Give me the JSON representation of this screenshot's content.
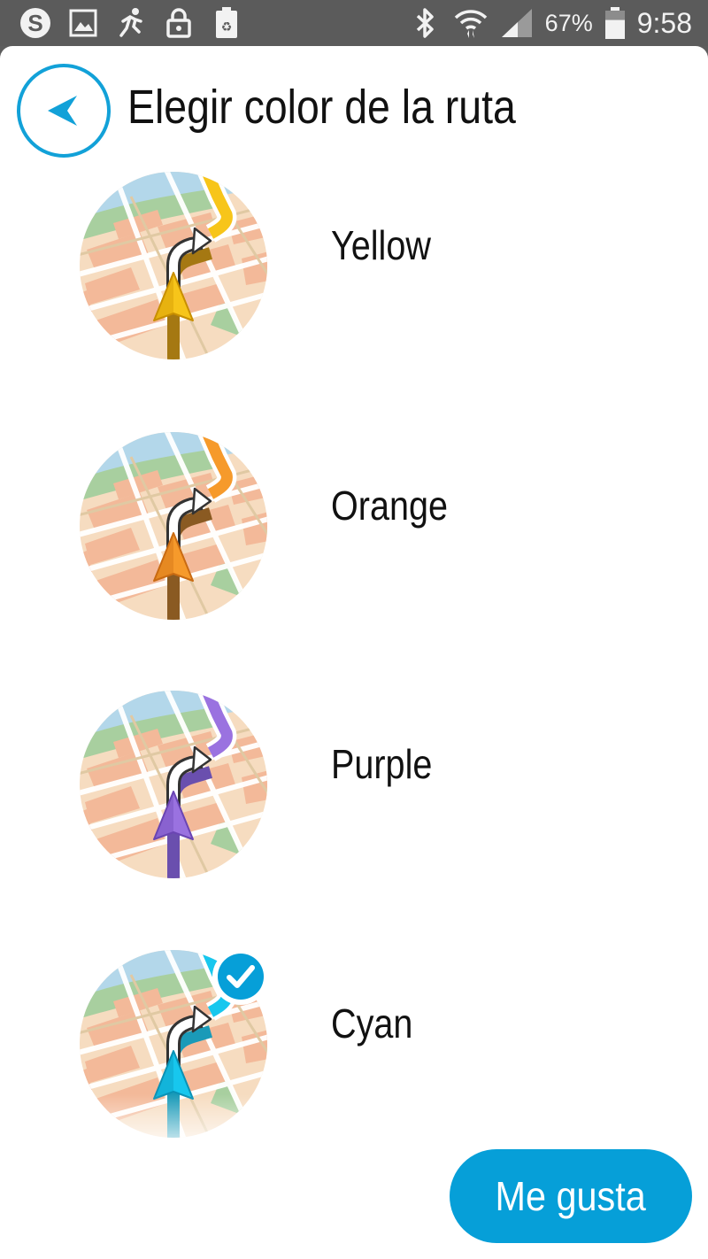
{
  "status_bar": {
    "icons_left": [
      "skype-icon",
      "gallery-icon",
      "runner-icon",
      "lock-icon",
      "recycle-battery-icon"
    ],
    "icons_right": [
      "bluetooth-icon",
      "wifi-icon",
      "signal-icon"
    ],
    "battery_percent": "67%",
    "battery_level": 0.67,
    "time": "9:58"
  },
  "header": {
    "back_icon": "back-arrow-icon",
    "title": "Elegir color de la ruta"
  },
  "route_colors": [
    {
      "label": "Yellow",
      "color": "#f7c51a",
      "arrow_dark": "#c88f00",
      "tail": "#a57812",
      "selected": false
    },
    {
      "label": "Orange",
      "color": "#f69a2b",
      "arrow_dark": "#c96b12",
      "tail": "#8a5a22",
      "selected": false
    },
    {
      "label": "Purple",
      "color": "#9a72e0",
      "arrow_dark": "#6a45b3",
      "tail": "#6a4fae",
      "selected": false
    },
    {
      "label": "Cyan",
      "color": "#17c7ee",
      "arrow_dark": "#0a91b5",
      "tail": "#1a9ab8",
      "selected": true
    }
  ],
  "selected_icon": "checkmark-icon",
  "accent_color": "#069fd8",
  "action_button": {
    "label": "Me gusta"
  }
}
